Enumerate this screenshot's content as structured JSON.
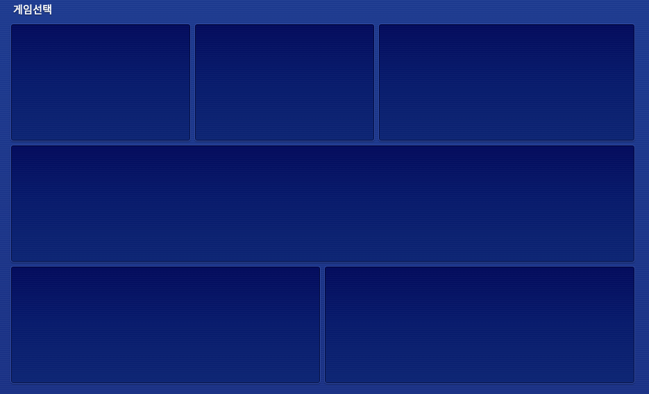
{
  "header": {
    "title": "게임선택"
  },
  "colors": {
    "background": "#1b3286",
    "panel_top": "#030b5c",
    "panel_bottom": "#0d2574",
    "panel_border": "#2f4aa6",
    "title_text": "#ffffff"
  },
  "game_tiles": [
    {
      "content": ""
    },
    {
      "content": ""
    },
    {
      "content": ""
    },
    {
      "content": ""
    },
    {
      "content": ""
    },
    {
      "content": ""
    }
  ]
}
